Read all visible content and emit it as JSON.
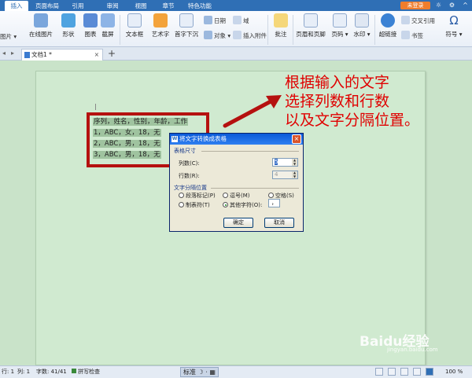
{
  "ribbon_tabs": [
    "插入",
    "页面布局",
    "引用",
    "审阅",
    "视图",
    "章节",
    "特色功能"
  ],
  "active_tab_index": 0,
  "login_button": "未登录",
  "ribbon": {
    "picture": "图片",
    "online_picture": "在线图片",
    "shape": "形状",
    "chart": "图表",
    "screenshot": "截屏",
    "textbox": "文本框",
    "wordart": "艺术字",
    "dropcap": "首字下沉",
    "date": "日期",
    "object": "对象",
    "field": "域",
    "attachment": "插入附件",
    "comment": "批注",
    "header_footer": "页眉和页脚",
    "page_number": "页码",
    "watermark": "水印",
    "hyperlink": "超链接",
    "cross_ref": "交叉引用",
    "bookmark": "书签",
    "symbol": "符号"
  },
  "document_tab": "文档1 *",
  "document_lines": [
    "序列，姓名，性别，年龄，工作",
    "1，ABC，女，18，无",
    "2，ABC，男，18，无",
    "3，ABC，男，18，无"
  ],
  "annotation": [
    "根据输入的文字",
    "选择列数和行数",
    "以及文字分隔位置。"
  ],
  "dialog": {
    "title": "将文字转换成表格",
    "size_group": "表格尺寸",
    "cols_label": "列数(C):",
    "cols_value": "5",
    "rows_label": "行数(R):",
    "rows_value": "4",
    "sep_group": "文字分隔位置",
    "opt_paragraph": "段落标记(P)",
    "opt_comma": "逗号(M)",
    "opt_space": "空格(S)",
    "opt_tab": "制表符(T)",
    "opt_other": "其他字符(O):",
    "other_char": "，",
    "selected_option": "opt_other",
    "ok": "确定",
    "cancel": "取消"
  },
  "status": {
    "row": "行: 1",
    "col": "列: 1",
    "wordcount": "字数: 41/41",
    "spellcheck": "拼写检查",
    "mode": "标准",
    "zoom": "100 %"
  },
  "watermark": {
    "logo": "Baidu经验",
    "url": "jingyan.baidu.com"
  },
  "colors": {
    "tabbar": "#2f6fb5",
    "page_bg": "#c9e3c9",
    "red_box": "#b5110f",
    "annotation": "#e00000"
  }
}
